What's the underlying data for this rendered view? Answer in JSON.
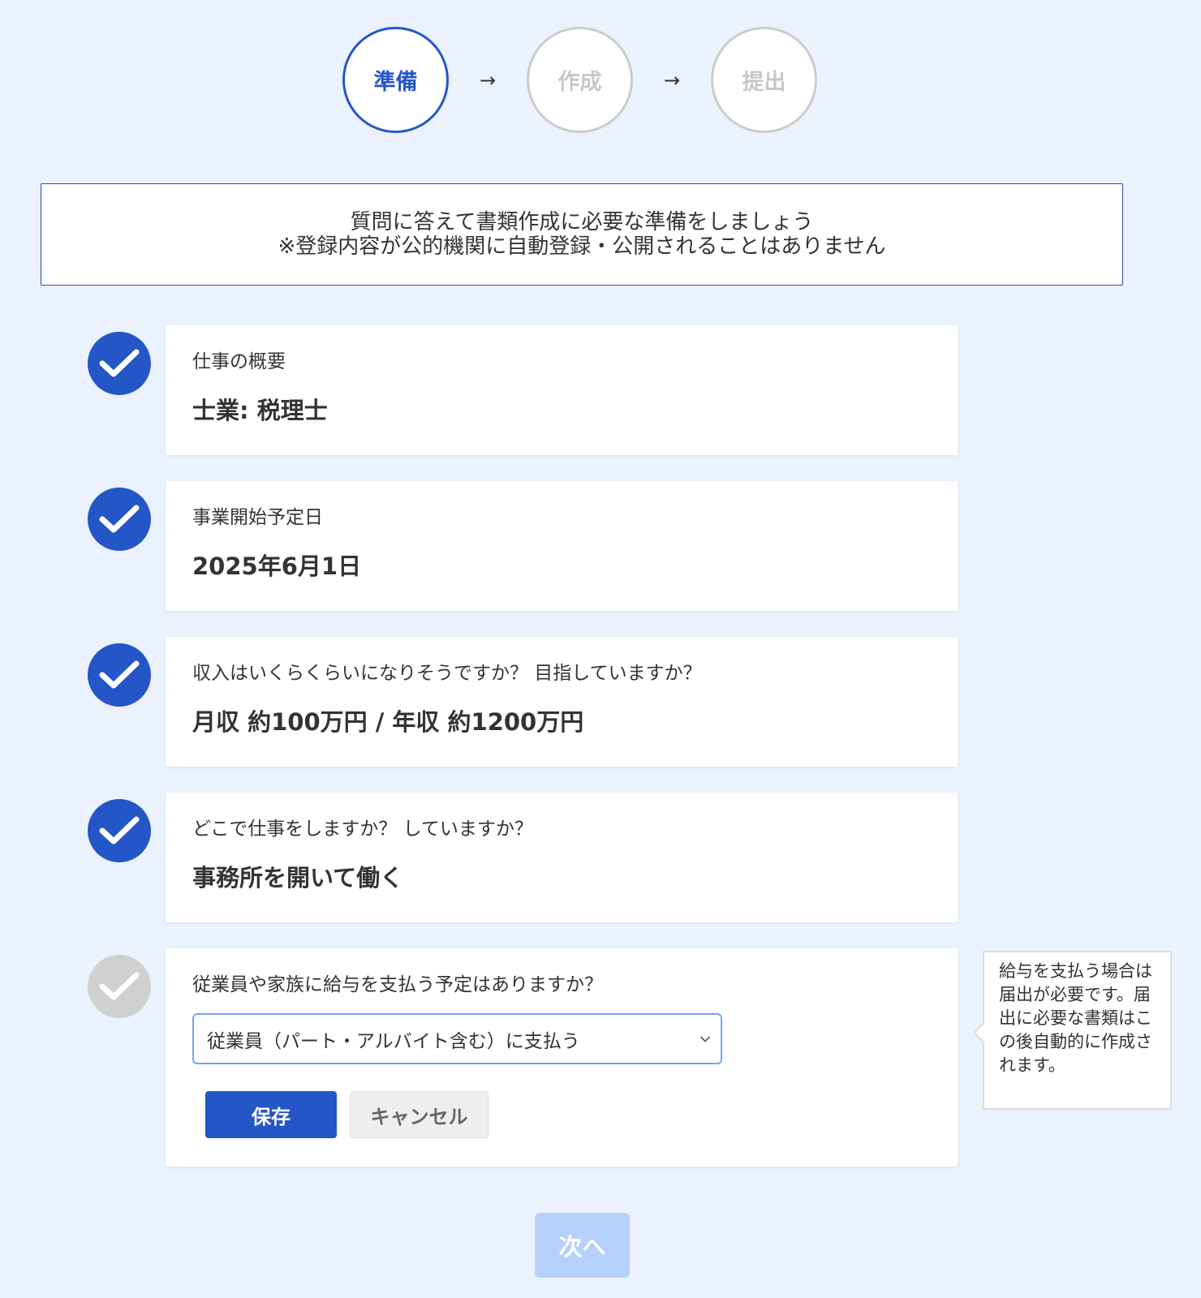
{
  "stepper": {
    "steps": [
      {
        "label": "準備",
        "state": "active"
      },
      {
        "label": "作成",
        "state": "inactive"
      },
      {
        "label": "提出",
        "state": "inactive"
      }
    ],
    "arrow": "→"
  },
  "notice": {
    "line1": "質問に答えて書類作成に必要な準備をしましょう",
    "line2": "※登録内容が公的機関に自動登録・公開されることはありません"
  },
  "questions": [
    {
      "question": "仕事の概要",
      "answer": "士業: 税理士",
      "status": "completed"
    },
    {
      "question": "事業開始予定日",
      "answer": "2025年6月1日",
      "status": "completed"
    },
    {
      "question": "収入はいくらくらいになりそうですか？ 目指していますか？",
      "answer": "月収 約100万円 / 年収 約1200万円",
      "status": "completed"
    },
    {
      "question": "どこで仕事をしますか？ していますか？",
      "answer": "事務所を開いて働く",
      "status": "completed"
    },
    {
      "question": "従業員や家族に給与を支払う予定はありますか？",
      "selected_option": "従業員（パート・アルバイト含む）に支払う",
      "status": "editing"
    }
  ],
  "actions": {
    "save_label": "保存",
    "cancel_label": "キャンセル",
    "next_label": "次へ"
  },
  "tooltip": {
    "text": "給与を支払う場合は届出が必要です。届出に必要な書類はこの後自動的に作成されます。"
  },
  "icons": {
    "check": "check-icon",
    "chevron": "chevron-down-icon"
  },
  "colors": {
    "accent": "#2556c8",
    "background": "#ebf2fd",
    "pending_check": "#d0d0d0",
    "next_disabled": "#b6d0fc",
    "select_focus": "#6fa5f0"
  }
}
